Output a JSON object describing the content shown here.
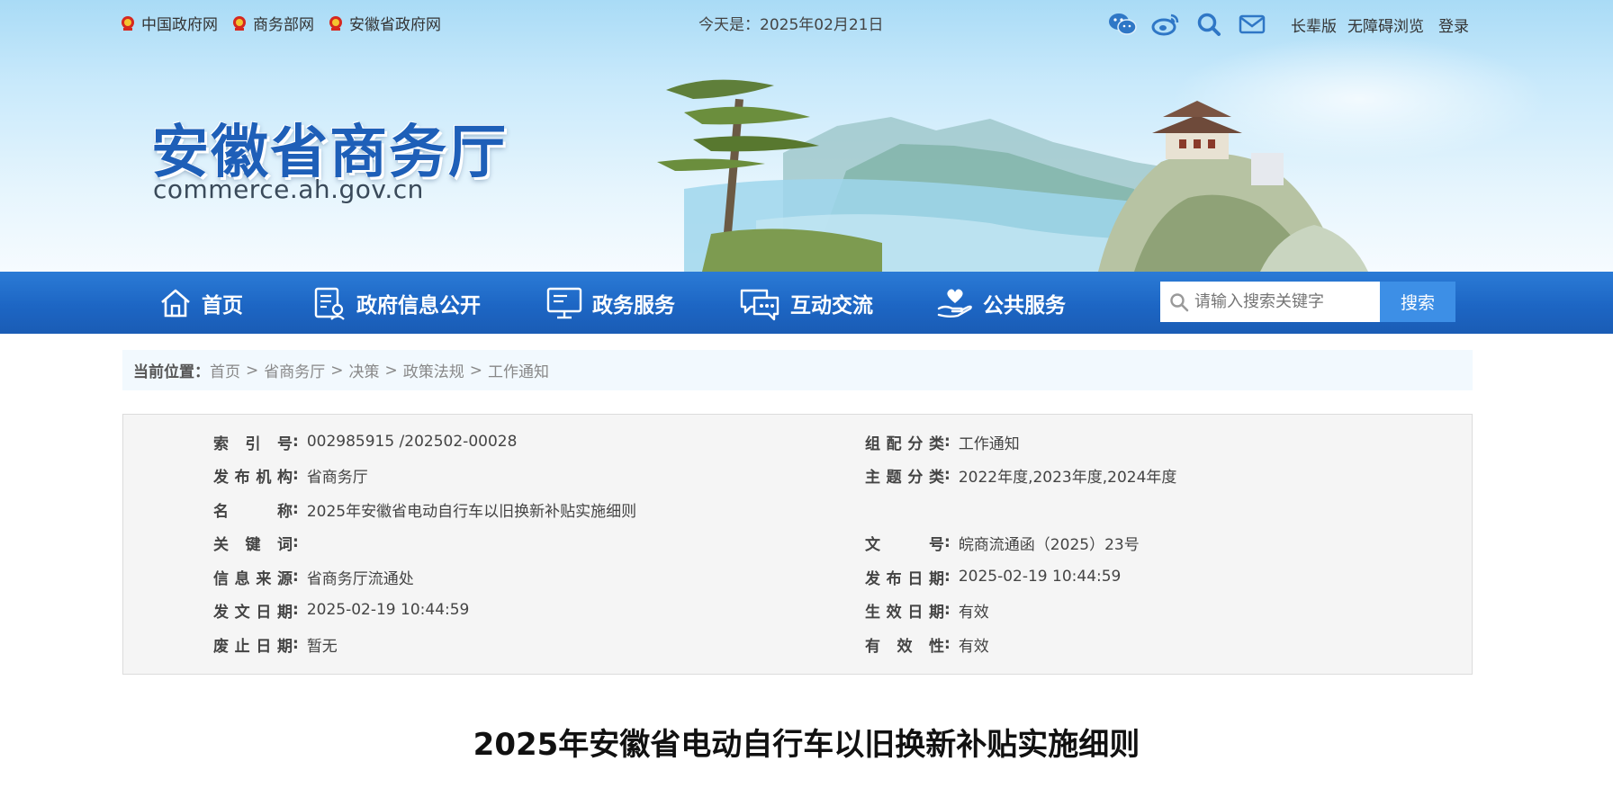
{
  "top_links": [
    {
      "label": "中国政府网"
    },
    {
      "label": "商务部网"
    },
    {
      "label": "安徽省政府网"
    }
  ],
  "today": "今天是：2025年02月21日",
  "toolbar": {
    "icons": [
      "wechat-icon",
      "weibo-icon",
      "search-icon",
      "mail-icon"
    ],
    "elder_mode": "长辈版",
    "accessibility": "无障碍浏览",
    "login": "登录"
  },
  "site": {
    "title": "安徽省商务厅",
    "domain": "commerce.ah.gov.cn"
  },
  "nav": {
    "items": [
      {
        "label": "首页",
        "icon": "home-icon"
      },
      {
        "label": "政府信息公开",
        "icon": "document-icon"
      },
      {
        "label": "政务服务",
        "icon": "monitor-icon"
      },
      {
        "label": "互动交流",
        "icon": "chat-icon"
      },
      {
        "label": "公共服务",
        "icon": "hand-heart-icon"
      }
    ],
    "search_placeholder": "请输入搜索关键字",
    "search_button": "搜索"
  },
  "breadcrumb": {
    "label": "当前位置：",
    "items": [
      "首页",
      "省商务厅",
      "决策",
      "政策法规",
      "工作通知"
    ],
    "separator": ">"
  },
  "info": {
    "left": [
      {
        "key": "索 引 号",
        "value": "002985915 /202502-00028"
      },
      {
        "key": "发布机构",
        "value": "省商务厅"
      },
      {
        "key": "名　　称",
        "value": "2025年安徽省电动自行车以旧换新补贴实施细则"
      },
      {
        "key": "关 键 词",
        "value": ""
      },
      {
        "key": "信息来源",
        "value": "省商务厅流通处"
      },
      {
        "key": "发文日期",
        "value": "2025-02-19 10:44:59"
      },
      {
        "key": "废止日期",
        "value": "暂无"
      }
    ],
    "right": [
      {
        "key": "组配分类",
        "value": "工作通知"
      },
      {
        "key": "主题分类",
        "value": "2022年度,2023年度,2024年度"
      },
      {
        "key": "文　　号",
        "value": "皖商流通函（2025）23号"
      },
      {
        "key": "发布日期",
        "value": "2025-02-19 10:44:59"
      },
      {
        "key": "生效日期",
        "value": "有效"
      },
      {
        "key": "有 效 性",
        "value": "有效"
      }
    ]
  },
  "article": {
    "title": "2025年安徽省电动自行车以旧换新补贴实施细则"
  },
  "colors": {
    "brand_blue": "#1e5fb8",
    "nav_blue": "#1d66c4",
    "search_button": "#3d8fe6"
  }
}
